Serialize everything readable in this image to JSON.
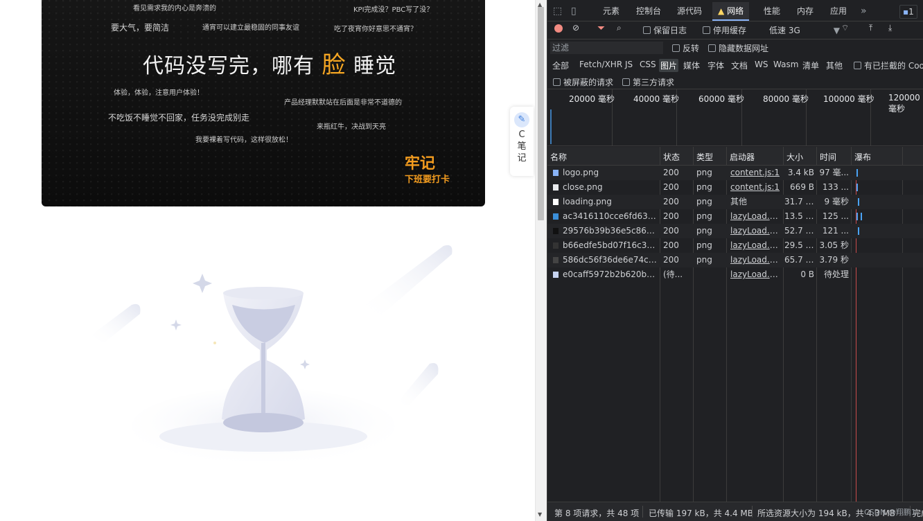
{
  "banner": {
    "lines": [
      {
        "text": "看见需求我的内心是奔溃的"
      },
      {
        "text": "KPI完成没？PBC写了没？"
      },
      {
        "text": "要大气，要简洁"
      },
      {
        "text": "通宵可以建立最稳固的同事友谊"
      },
      {
        "text": "吃了夜宵你好意思不通宵？"
      },
      {
        "text": "体验，体验，注意用户体验！"
      },
      {
        "text": "产品经理默默站在后面是非常不道德的"
      },
      {
        "text": "不吃饭不睡觉不回家，任务没完成别走"
      },
      {
        "text": "来瓶红牛，决战到天亮"
      },
      {
        "text": "我要裸着写代码，这样很放松！"
      }
    ],
    "headline_before": "代码没写完，哪有",
    "headline_highlight": "脸",
    "headline_after": "睡觉",
    "seal_title": "牢记",
    "seal_subtitle": "下班要打卡"
  },
  "side_panel": {
    "icon": "note-icon",
    "label_c": "C",
    "label_1": "笔",
    "label_2": "记"
  },
  "devtools": {
    "tabs": [
      "元素",
      "控制台",
      "源代码",
      "网络",
      "性能",
      "内存",
      "应用"
    ],
    "active_tab": "网络",
    "issues_count": "1",
    "toolbar": {
      "preserve_log": "保留日志",
      "disable_cache": "停用缓存",
      "throttle": "低速 3G"
    },
    "filter": {
      "placeholder": "过滤",
      "invert": "反转",
      "hide_data_urls": "隐藏数据网址"
    },
    "types": [
      "全部",
      "Fetch/XHR",
      "JS",
      "CSS",
      "图片",
      "媒体",
      "字体",
      "文档",
      "WS",
      "Wasm",
      "清单",
      "其他"
    ],
    "selected_type": "图片",
    "blocked_cookies": "有已拦截的 Coo",
    "blocked_requests": "被屏蔽的请求",
    "third_party": "第三方请求",
    "overview_ticks": [
      "20000 毫秒",
      "40000 毫秒",
      "60000 毫秒",
      "80000 毫秒",
      "100000 毫秒",
      "120000 毫秒"
    ],
    "columns": {
      "name": "名称",
      "status": "状态",
      "type": "类型",
      "initiator": "启动器",
      "size": "大小",
      "time": "时间",
      "waterfall": "瀑布"
    },
    "requests": [
      {
        "name": "logo.png",
        "status": "200",
        "type": "png",
        "initiator": "content.js:1",
        "size": "3.4 kB",
        "time": "97 毫...",
        "icon_color": "#8ab4f8"
      },
      {
        "name": "close.png",
        "status": "200",
        "type": "png",
        "initiator": "content.js:1",
        "size": "669 B",
        "time": "133 ...",
        "icon_color": "#e8eaed"
      },
      {
        "name": "loading.png",
        "status": "200",
        "type": "png",
        "initiator": "其他",
        "size": "31.7 kB",
        "time": "9 毫秒",
        "icon_color": "#ffffff"
      },
      {
        "name": "ac3416110cce6fd635d...",
        "status": "200",
        "type": "png",
        "initiator": "lazyLoad.ts:...",
        "size": "13.5 kB",
        "time": "125 ...",
        "icon_color": "#3b8fd9"
      },
      {
        "name": "29576b39b36e5c8681e...",
        "status": "200",
        "type": "png",
        "initiator": "lazyLoad.ts:...",
        "size": "52.7 kB",
        "time": "121 ...",
        "icon_color": "#111111"
      },
      {
        "name": "b66edfe5bd07f16c324...",
        "status": "200",
        "type": "png",
        "initiator": "lazyLoad.ts:...",
        "size": "29.5 kB",
        "time": "3.05 秒",
        "icon_color": "#333333"
      },
      {
        "name": "586dc56f36de6e74c6a...",
        "status": "200",
        "type": "png",
        "initiator": "lazyLoad.ts:...",
        "size": "65.7 kB",
        "time": "3.79 秒",
        "icon_color": "#444444"
      },
      {
        "name": "e0caff5972b2b620b0a...",
        "status": "(待...",
        "type": "",
        "initiator": "lazyLoad.ts:...",
        "size": "0 B",
        "time": "待处理",
        "icon_color": "#c6d3f0"
      }
    ],
    "status": {
      "requests": "第 8 项请求，共 48 项",
      "transferred": "已传输 197 kB，共 4.4 MB",
      "resources": "所选资源大小为 194 kB，共 4.3 MB",
      "finish": "完成用"
    },
    "watermark": "CSDN @翔鹏1"
  },
  "colors": {
    "accent": "#1a73e8",
    "banner_highlight": "#f5a623",
    "panel_bg": "#202124"
  }
}
